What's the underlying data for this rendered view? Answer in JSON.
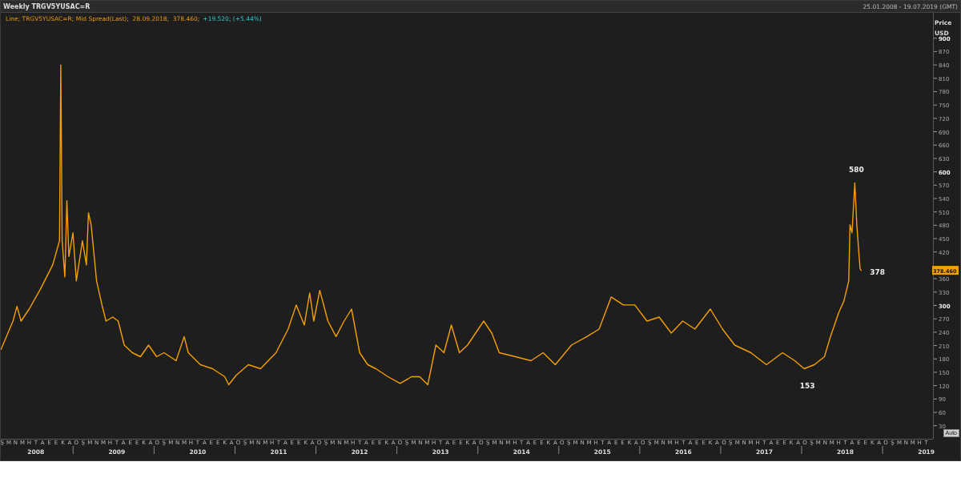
{
  "window": {
    "title": "Weekly TRGV5YUSAC=R",
    "date_range": "25.01.2008 - 19.07.2019 (GMT)"
  },
  "legend": {
    "type_label": "Line;",
    "detail": "; Mid Spread(Last);  28.09.2018;  378.460;",
    "change": "+19.520; (+5.44%)"
  },
  "y_axis": {
    "title": "Price",
    "unit": "USD",
    "current_value": "378.460"
  },
  "x_axis": {
    "months": [
      "Ş",
      "M",
      "N",
      "M",
      "H",
      "T",
      "A",
      "E",
      "E",
      "K",
      "A",
      "O",
      "Ş",
      "M",
      "N",
      "M",
      "H",
      "T",
      "A",
      "E",
      "E",
      "K",
      "A",
      "O",
      "Ş",
      "M",
      "N",
      "M",
      "H",
      "T",
      "A",
      "E",
      "E",
      "K",
      "A",
      "O",
      "Ş",
      "M",
      "N",
      "M",
      "H",
      "T",
      "A",
      "E",
      "E",
      "K",
      "A",
      "O",
      "Ş",
      "M",
      "N",
      "M",
      "H",
      "T",
      "A",
      "E",
      "E",
      "K",
      "A",
      "O",
      "Ş",
      "M",
      "N",
      "M",
      "H",
      "T",
      "A",
      "E",
      "E",
      "K",
      "A",
      "O",
      "Ş",
      "M",
      "N",
      "M",
      "H",
      "T",
      "A",
      "E",
      "E",
      "K",
      "A",
      "O",
      "Ş",
      "M",
      "N",
      "M",
      "H",
      "T",
      "A",
      "E",
      "E",
      "K",
      "A",
      "O",
      "Ş",
      "M",
      "N",
      "M",
      "H",
      "T",
      "A",
      "E",
      "E",
      "K",
      "A",
      "O",
      "Ş",
      "M",
      "N",
      "M",
      "H",
      "T",
      "A",
      "E",
      "E",
      "K",
      "A",
      "O",
      "Ş",
      "M",
      "N",
      "M",
      "H",
      "T",
      "A",
      "E",
      "E",
      "K",
      "A",
      "O",
      "Ş",
      "M",
      "N",
      "M",
      "H",
      "T"
    ]
  },
  "auto_button": "Auto",
  "chart_data": {
    "type": "line",
    "xlim": [
      2008.067,
      2019.583
    ],
    "ylim": [
      0,
      957
    ],
    "yticks": [
      30,
      60,
      90,
      120,
      150,
      180,
      210,
      240,
      270,
      300,
      330,
      360,
      420,
      450,
      480,
      510,
      540,
      570,
      600,
      630,
      660,
      690,
      720,
      750,
      780,
      810,
      840,
      870,
      900
    ],
    "xticks": [
      {
        "value": 2008.5,
        "label": "2008"
      },
      {
        "value": 2009.5,
        "label": "2009"
      },
      {
        "value": 2010.5,
        "label": "2010"
      },
      {
        "value": 2011.5,
        "label": "2011"
      },
      {
        "value": 2012.5,
        "label": "2012"
      },
      {
        "value": 2013.5,
        "label": "2013"
      },
      {
        "value": 2014.5,
        "label": "2014"
      },
      {
        "value": 2015.5,
        "label": "2015"
      },
      {
        "value": 2016.5,
        "label": "2016"
      },
      {
        "value": 2017.5,
        "label": "2017"
      },
      {
        "value": 2018.5,
        "label": "2018"
      },
      {
        "value": 2019.5,
        "label": "2019"
      }
    ],
    "x": [
      2008.067,
      2008.217,
      2008.267,
      2008.317,
      2008.417,
      2008.558,
      2008.708,
      2008.792,
      2008.808,
      2008.825,
      2008.858,
      2008.883,
      2008.908,
      2008.958,
      2009,
      2009.075,
      2009.125,
      2009.15,
      2009.183,
      2009.25,
      2009.317,
      2009.367,
      2009.45,
      2009.517,
      2009.592,
      2009.692,
      2009.792,
      2009.892,
      2009.992,
      2010.083,
      2010.233,
      2010.333,
      2010.383,
      2010.533,
      2010.683,
      2010.833,
      2010.883,
      2010.975,
      2011.125,
      2011.275,
      2011.467,
      2011.617,
      2011.717,
      2011.817,
      2011.883,
      2011.933,
      2012.008,
      2012.108,
      2012.208,
      2012.308,
      2012.4,
      2012.5,
      2012.6,
      2012.7,
      2012.85,
      2013,
      2013.142,
      2013.242,
      2013.342,
      2013.442,
      2013.542,
      2013.633,
      2013.733,
      2013.833,
      2014.033,
      2014.133,
      2014.225,
      2014.425,
      2014.617,
      2014.767,
      2014.917,
      2015.117,
      2015.308,
      2015.458,
      2015.608,
      2015.758,
      2015.9,
      2016.05,
      2016.2,
      2016.35,
      2016.492,
      2016.642,
      2016.833,
      2016.983,
      2017.133,
      2017.333,
      2017.525,
      2017.725,
      2017.875,
      2017.992,
      2018.117,
      2018.242,
      2018.317,
      2018.417,
      2018.483,
      2018.542,
      2018.558,
      2018.583,
      2018.617,
      2018.642,
      2018.667,
      2018.683,
      2018.7
    ],
    "series": [
      {
        "name": "TRGV5YUSAC=R",
        "color": "#f5a000",
        "values": [
          200,
          265,
          298,
          265,
          292,
          337,
          391,
          445,
          840,
          445,
          364,
          535,
          410,
          463,
          355,
          445,
          391,
          508,
          481,
          355,
          301,
          265,
          274,
          265,
          211,
          194,
          185,
          211,
          185,
          194,
          176,
          230,
          194,
          167,
          158,
          140,
          122,
          143,
          167,
          158,
          194,
          247,
          301,
          256,
          328,
          265,
          334,
          265,
          230,
          265,
          292,
          194,
          167,
          158,
          140,
          125,
          140,
          140,
          122,
          211,
          194,
          256,
          194,
          211,
          265,
          238,
          194,
          185,
          176,
          194,
          167,
          211,
          230,
          247,
          319,
          301,
          301,
          265,
          274,
          238,
          265,
          247,
          292,
          247,
          211,
          194,
          167,
          194,
          176,
          158,
          167,
          185,
          230,
          283,
          310,
          355,
          481,
          463,
          575,
          481,
          420,
          382,
          378
        ]
      }
    ],
    "annotations": [
      {
        "x": 2018.617,
        "y": 575,
        "text": "580"
      },
      {
        "x": 2018.7,
        "y": 378,
        "text": "378"
      },
      {
        "x": 2017.992,
        "y": 158,
        "text": "153"
      }
    ]
  }
}
